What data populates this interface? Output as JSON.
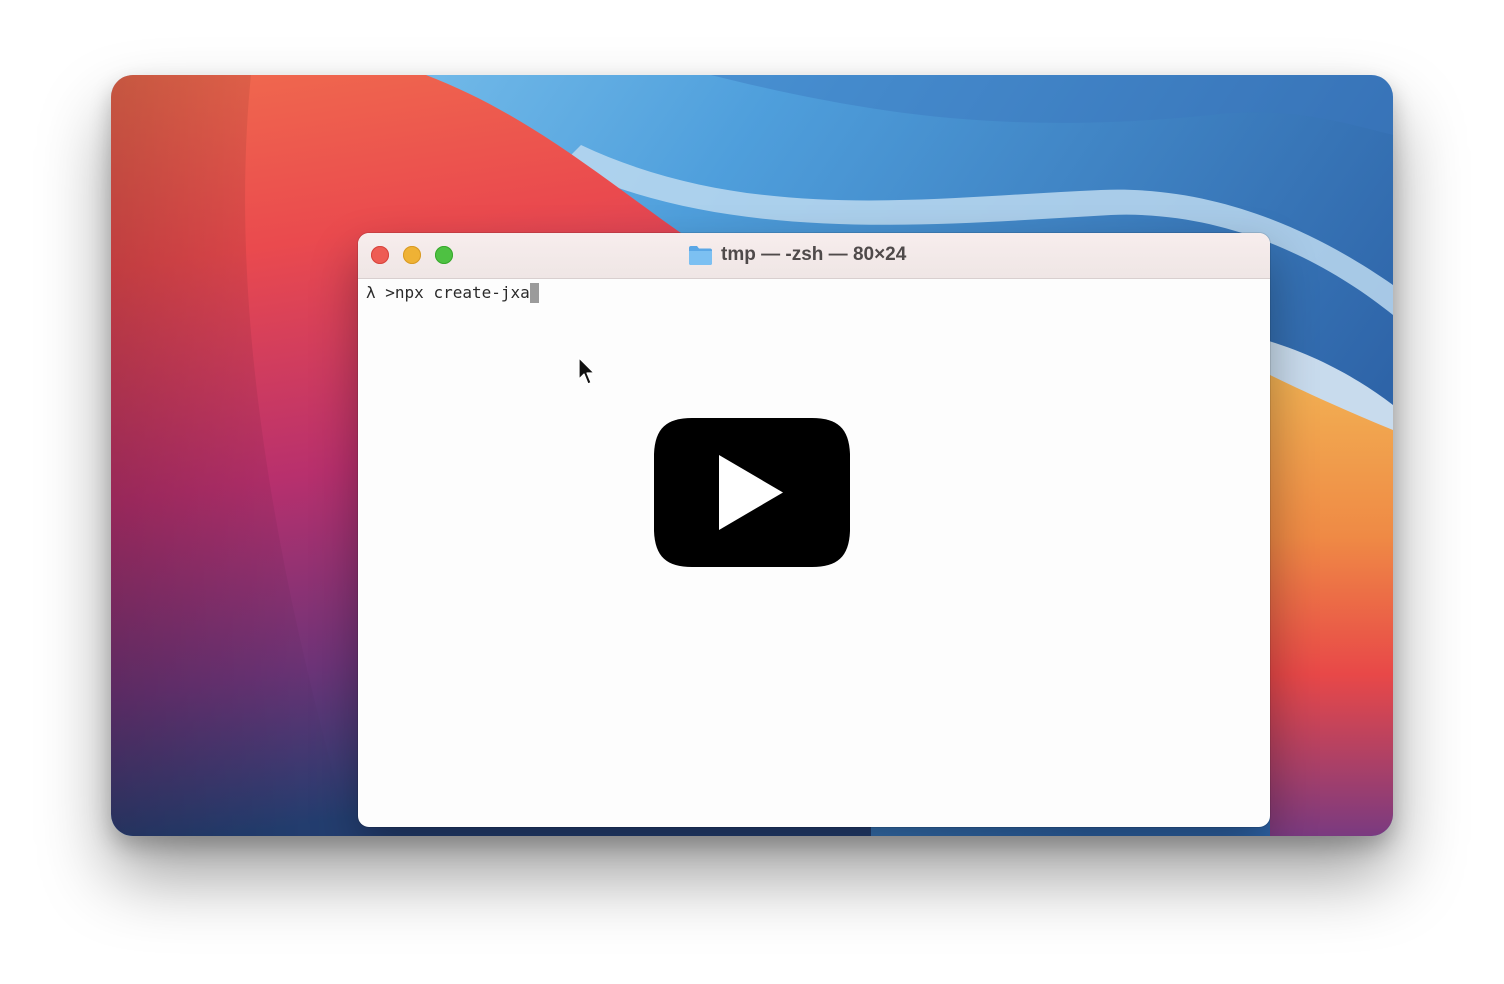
{
  "colors": {
    "close": "#ee5c54",
    "minimize": "#efb235",
    "zoom": "#4ec142",
    "folder": "#5aa7e6",
    "play_button": "#000000"
  },
  "terminal": {
    "title": "tmp — -zsh — 80×24",
    "prompt": "λ >",
    "command": "npx create-jxa"
  },
  "icons": {
    "folder": "folder-icon",
    "play": "play-icon",
    "pointer": "mouse-pointer-icon"
  }
}
